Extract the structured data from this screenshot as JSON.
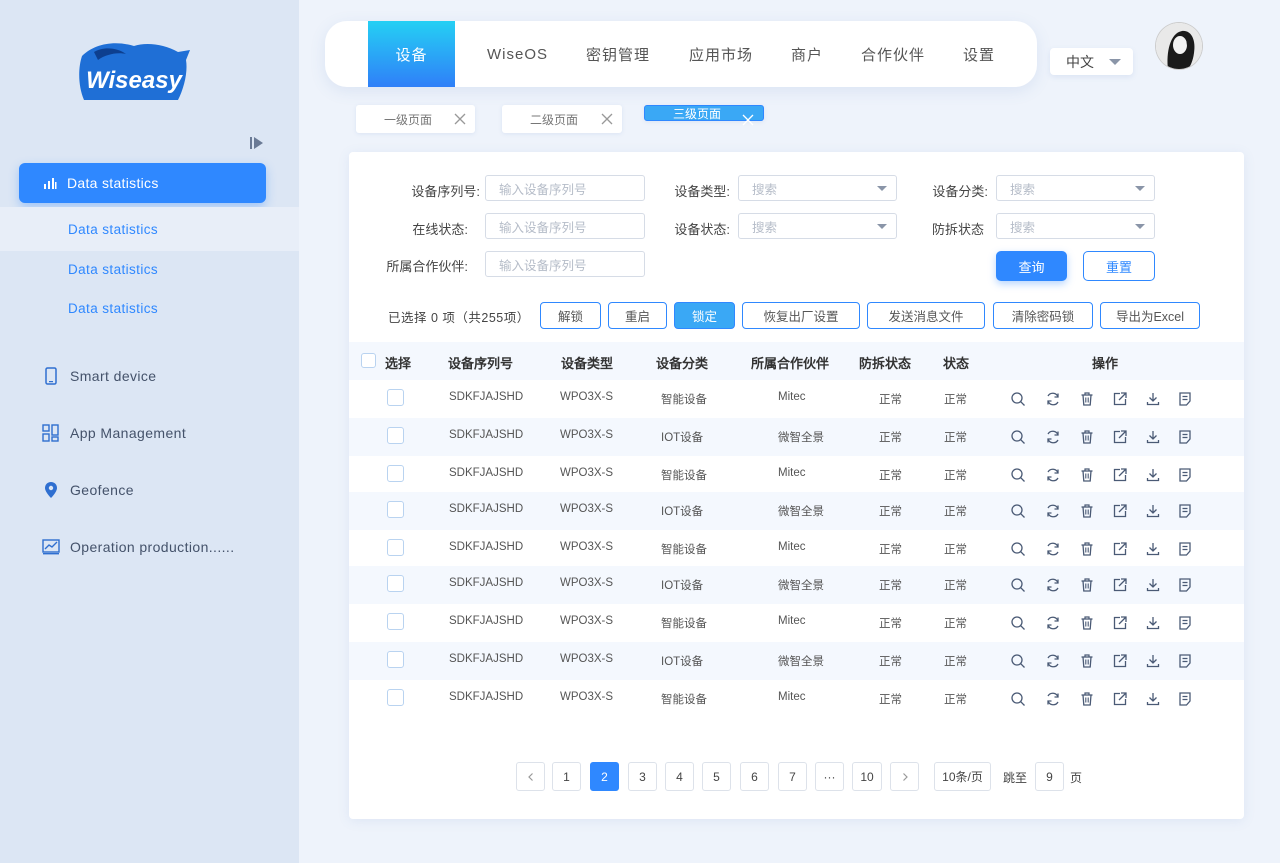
{
  "brand": {
    "name": "Wiseasy"
  },
  "sidebar": {
    "active": "Data statistics",
    "subitems": [
      "Data statistics",
      "Data statistics",
      "Data statistics"
    ],
    "items": [
      "Smart device",
      "App Management",
      "Geofence",
      "Operation production......"
    ]
  },
  "topnav": {
    "tabs": [
      "设备",
      "WiseOS",
      "密钥管理",
      "应用市场",
      "商户",
      "合作伙伴",
      "设置"
    ],
    "language": "中文"
  },
  "page_tabs": [
    "一级页面",
    "二级页面",
    "三级页面"
  ],
  "filters": {
    "serial_label": "设备序列号:",
    "serial_placeholder": "输入设备序列号",
    "type_label": "设备类型:",
    "type_placeholder": "搜索",
    "category_label": "设备分类:",
    "category_placeholder": "搜索",
    "online_label": "在线状态:",
    "online_placeholder": "输入设备序列号",
    "status_label": "设备状态:",
    "status_placeholder": "搜索",
    "tamper_label": "防拆状态",
    "tamper_placeholder": "搜索",
    "partner_label": "所属合作伙伴:",
    "partner_placeholder": "输入设备序列号",
    "query": "查询",
    "reset": "重置"
  },
  "selection": {
    "text": "已选择 0 项（共255项）"
  },
  "actions": [
    "解锁",
    "重启",
    "锁定",
    "恢复出厂设置",
    "发送消息文件",
    "清除密码锁",
    "导出为Excel"
  ],
  "table": {
    "headers": [
      "选择",
      "设备序列号",
      "设备类型",
      "设备分类",
      "所属合作伙伴",
      "防拆状态",
      "状态",
      "操作"
    ],
    "rows": [
      [
        "SDKFJAJSHD",
        "WPO3X-S",
        "智能设备",
        "Mitec",
        "正常",
        "正常"
      ],
      [
        "SDKFJAJSHD",
        "WPO3X-S",
        "IOT设备",
        "微智全景",
        "正常",
        "正常"
      ],
      [
        "SDKFJAJSHD",
        "WPO3X-S",
        "智能设备",
        "Mitec",
        "正常",
        "正常"
      ],
      [
        "SDKFJAJSHD",
        "WPO3X-S",
        "IOT设备",
        "微智全景",
        "正常",
        "正常"
      ],
      [
        "SDKFJAJSHD",
        "WPO3X-S",
        "智能设备",
        "Mitec",
        "正常",
        "正常"
      ],
      [
        "SDKFJAJSHD",
        "WPO3X-S",
        "IOT设备",
        "微智全景",
        "正常",
        "正常"
      ],
      [
        "SDKFJAJSHD",
        "WPO3X-S",
        "智能设备",
        "Mitec",
        "正常",
        "正常"
      ],
      [
        "SDKFJAJSHD",
        "WPO3X-S",
        "IOT设备",
        "微智全景",
        "正常",
        "正常"
      ],
      [
        "SDKFJAJSHD",
        "WPO3X-S",
        "智能设备",
        "Mitec",
        "正常",
        "正常"
      ]
    ],
    "row_icons": [
      "search-icon",
      "refresh-icon",
      "trash-icon",
      "external-link-icon",
      "download-icon",
      "document-icon"
    ]
  },
  "pagination": {
    "pages": [
      "1",
      "2",
      "3",
      "4",
      "5",
      "6",
      "7",
      "···",
      "10"
    ],
    "current": "2",
    "page_size": "10条/页",
    "goto_label": "跳至",
    "goto_value": "9",
    "goto_suffix": "页"
  },
  "colors": {
    "primary": "#2f88ff",
    "accent": "#25d0f4",
    "sidebar": "#dce6f4",
    "background": "#eef3fb"
  }
}
